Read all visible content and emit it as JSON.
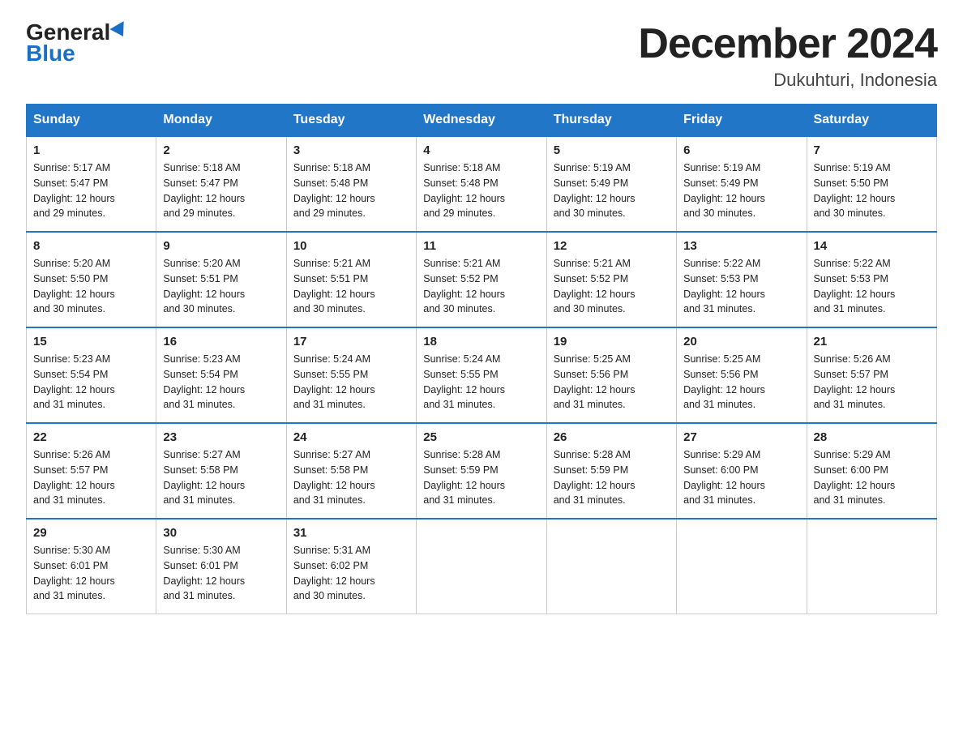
{
  "logo": {
    "general": "General",
    "blue": "Blue"
  },
  "title": "December 2024",
  "location": "Dukuhturi, Indonesia",
  "days_of_week": [
    "Sunday",
    "Monday",
    "Tuesday",
    "Wednesday",
    "Thursday",
    "Friday",
    "Saturday"
  ],
  "weeks": [
    [
      {
        "day": "1",
        "sunrise": "5:17 AM",
        "sunset": "5:47 PM",
        "daylight": "12 hours and 29 minutes."
      },
      {
        "day": "2",
        "sunrise": "5:18 AM",
        "sunset": "5:47 PM",
        "daylight": "12 hours and 29 minutes."
      },
      {
        "day": "3",
        "sunrise": "5:18 AM",
        "sunset": "5:48 PM",
        "daylight": "12 hours and 29 minutes."
      },
      {
        "day": "4",
        "sunrise": "5:18 AM",
        "sunset": "5:48 PM",
        "daylight": "12 hours and 29 minutes."
      },
      {
        "day": "5",
        "sunrise": "5:19 AM",
        "sunset": "5:49 PM",
        "daylight": "12 hours and 30 minutes."
      },
      {
        "day": "6",
        "sunrise": "5:19 AM",
        "sunset": "5:49 PM",
        "daylight": "12 hours and 30 minutes."
      },
      {
        "day": "7",
        "sunrise": "5:19 AM",
        "sunset": "5:50 PM",
        "daylight": "12 hours and 30 minutes."
      }
    ],
    [
      {
        "day": "8",
        "sunrise": "5:20 AM",
        "sunset": "5:50 PM",
        "daylight": "12 hours and 30 minutes."
      },
      {
        "day": "9",
        "sunrise": "5:20 AM",
        "sunset": "5:51 PM",
        "daylight": "12 hours and 30 minutes."
      },
      {
        "day": "10",
        "sunrise": "5:21 AM",
        "sunset": "5:51 PM",
        "daylight": "12 hours and 30 minutes."
      },
      {
        "day": "11",
        "sunrise": "5:21 AM",
        "sunset": "5:52 PM",
        "daylight": "12 hours and 30 minutes."
      },
      {
        "day": "12",
        "sunrise": "5:21 AM",
        "sunset": "5:52 PM",
        "daylight": "12 hours and 30 minutes."
      },
      {
        "day": "13",
        "sunrise": "5:22 AM",
        "sunset": "5:53 PM",
        "daylight": "12 hours and 31 minutes."
      },
      {
        "day": "14",
        "sunrise": "5:22 AM",
        "sunset": "5:53 PM",
        "daylight": "12 hours and 31 minutes."
      }
    ],
    [
      {
        "day": "15",
        "sunrise": "5:23 AM",
        "sunset": "5:54 PM",
        "daylight": "12 hours and 31 minutes."
      },
      {
        "day": "16",
        "sunrise": "5:23 AM",
        "sunset": "5:54 PM",
        "daylight": "12 hours and 31 minutes."
      },
      {
        "day": "17",
        "sunrise": "5:24 AM",
        "sunset": "5:55 PM",
        "daylight": "12 hours and 31 minutes."
      },
      {
        "day": "18",
        "sunrise": "5:24 AM",
        "sunset": "5:55 PM",
        "daylight": "12 hours and 31 minutes."
      },
      {
        "day": "19",
        "sunrise": "5:25 AM",
        "sunset": "5:56 PM",
        "daylight": "12 hours and 31 minutes."
      },
      {
        "day": "20",
        "sunrise": "5:25 AM",
        "sunset": "5:56 PM",
        "daylight": "12 hours and 31 minutes."
      },
      {
        "day": "21",
        "sunrise": "5:26 AM",
        "sunset": "5:57 PM",
        "daylight": "12 hours and 31 minutes."
      }
    ],
    [
      {
        "day": "22",
        "sunrise": "5:26 AM",
        "sunset": "5:57 PM",
        "daylight": "12 hours and 31 minutes."
      },
      {
        "day": "23",
        "sunrise": "5:27 AM",
        "sunset": "5:58 PM",
        "daylight": "12 hours and 31 minutes."
      },
      {
        "day": "24",
        "sunrise": "5:27 AM",
        "sunset": "5:58 PM",
        "daylight": "12 hours and 31 minutes."
      },
      {
        "day": "25",
        "sunrise": "5:28 AM",
        "sunset": "5:59 PM",
        "daylight": "12 hours and 31 minutes."
      },
      {
        "day": "26",
        "sunrise": "5:28 AM",
        "sunset": "5:59 PM",
        "daylight": "12 hours and 31 minutes."
      },
      {
        "day": "27",
        "sunrise": "5:29 AM",
        "sunset": "6:00 PM",
        "daylight": "12 hours and 31 minutes."
      },
      {
        "day": "28",
        "sunrise": "5:29 AM",
        "sunset": "6:00 PM",
        "daylight": "12 hours and 31 minutes."
      }
    ],
    [
      {
        "day": "29",
        "sunrise": "5:30 AM",
        "sunset": "6:01 PM",
        "daylight": "12 hours and 31 minutes."
      },
      {
        "day": "30",
        "sunrise": "5:30 AM",
        "sunset": "6:01 PM",
        "daylight": "12 hours and 31 minutes."
      },
      {
        "day": "31",
        "sunrise": "5:31 AM",
        "sunset": "6:02 PM",
        "daylight": "12 hours and 30 minutes."
      },
      null,
      null,
      null,
      null
    ]
  ],
  "labels": {
    "sunrise": "Sunrise:",
    "sunset": "Sunset:",
    "daylight": "Daylight: 12 hours"
  }
}
